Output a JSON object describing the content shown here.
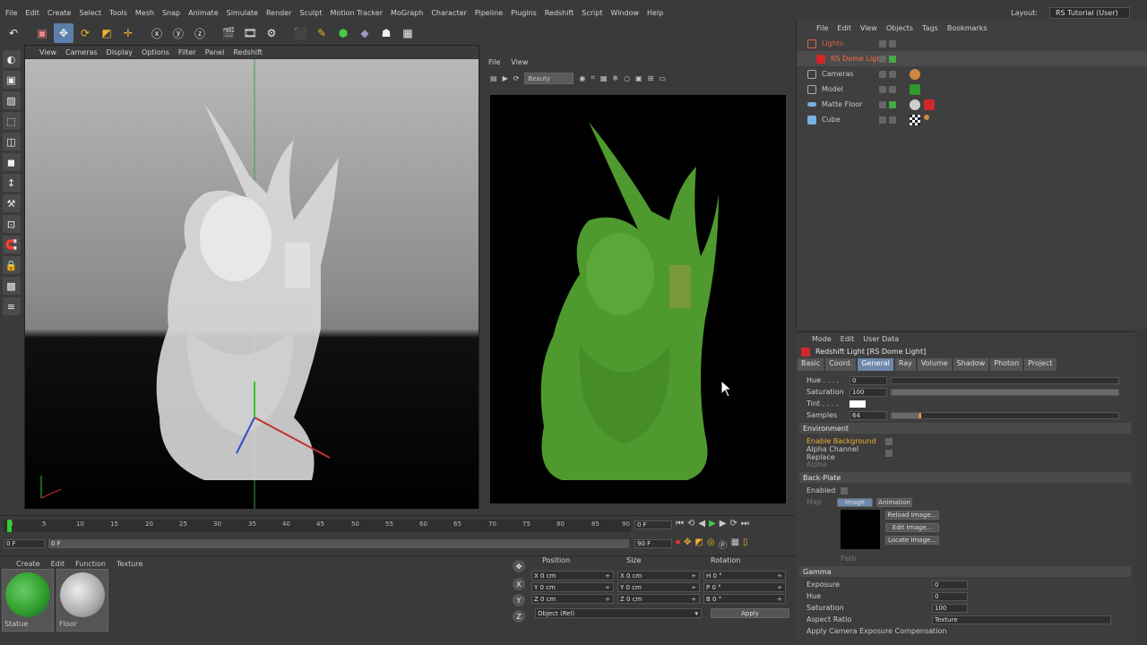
{
  "menubar": {
    "items": [
      "File",
      "Edit",
      "Create",
      "Select",
      "Tools",
      "Mesh",
      "Snap",
      "Animate",
      "Simulate",
      "Render",
      "Sculpt",
      "Motion Tracker",
      "MoGraph",
      "Character",
      "Pipeline",
      "Plugins",
      "Redshift",
      "Script",
      "Window",
      "Help"
    ],
    "layout_label": "Layout:",
    "layout_value": "RS Tutorial (User)"
  },
  "viewport": {
    "menu": [
      "View",
      "Cameras",
      "Display",
      "Options",
      "Filter",
      "Panel",
      "Redshift"
    ]
  },
  "renderview": {
    "menu": [
      "File",
      "View"
    ],
    "pass_dropdown": "Beauty"
  },
  "object_manager": {
    "menu": [
      "File",
      "Edit",
      "View",
      "Objects",
      "Tags",
      "Bookmarks"
    ],
    "rows": [
      {
        "name": "Lights",
        "color": "#e06040"
      },
      {
        "name": "RS Dome Light",
        "color": "#ff6b4a"
      },
      {
        "name": "Cameras",
        "color": "#d0d0d0"
      },
      {
        "name": "Model",
        "color": "#d0d0d0"
      },
      {
        "name": "Matte Floor",
        "color": "#d0d0d0"
      },
      {
        "name": "Cube",
        "color": "#d0d0d0"
      }
    ]
  },
  "attributes": {
    "menu": [
      "Mode",
      "Edit",
      "User Data"
    ],
    "title": "Redshift Light [RS Dome Light]",
    "tabs": [
      "Basic",
      "Coord.",
      "General",
      "Ray",
      "Volume",
      "Shadow",
      "Photon",
      "Project"
    ],
    "active_tab": "General",
    "fields": {
      "hue_label": "Hue . . . .",
      "hue_value": "0",
      "saturation_label": "Saturation",
      "saturation_value": "100",
      "tint_label": "Tint . . . .",
      "samples_label": "Samples",
      "samples_value": "64"
    },
    "environment": {
      "header": "Environment",
      "enable_background": "Enable Background",
      "alpha_channel_replace": "Alpha Channel Replace",
      "alpha": "Alpha"
    },
    "backplate": {
      "header": "Back-Plate",
      "enabled": "Enabled",
      "map": "Map",
      "image_btn": "Image",
      "animation_btn": "Animation",
      "reload": "Reload Image...",
      "edit": "Edit Image...",
      "locate": "Locate Image...",
      "path": "Path"
    },
    "gamma": {
      "header": "Gamma",
      "exposure": "Exposure",
      "exposure_value": "0",
      "hue": "Hue",
      "hue_value": "0",
      "saturation": "Saturation",
      "saturation_value": "100",
      "aspect_ratio": "Aspect Ratio",
      "aspect_value": "Texture",
      "apply_cam": "Apply Camera Exposure Compensation"
    }
  },
  "timeline": {
    "ticks": [
      "0",
      "5",
      "10",
      "15",
      "20",
      "25",
      "30",
      "35",
      "40",
      "45",
      "50",
      "55",
      "60",
      "65",
      "70",
      "75",
      "80",
      "85",
      "90"
    ],
    "current_frame": "0 F",
    "start_frame": "0 F",
    "range_start": "0 F",
    "range_end": "90 F",
    "end_frame": "90 F"
  },
  "materials": {
    "menu": [
      "Create",
      "Edit",
      "Function",
      "Texture"
    ],
    "items": [
      {
        "name": "Statue",
        "color": "#2f9a2a"
      },
      {
        "name": "Floor",
        "color": "#c8c8c8"
      }
    ]
  },
  "coords": {
    "headers": [
      "Position",
      "Size",
      "Rotation"
    ],
    "rows": [
      {
        "a": "X",
        "av": "0 cm",
        "b": "X",
        "bv": "0 cm",
        "c": "H",
        "cv": "0 °"
      },
      {
        "a": "Y",
        "av": "0 cm",
        "b": "Y",
        "bv": "0 cm",
        "c": "P",
        "cv": "0 °"
      },
      {
        "a": "Z",
        "av": "0 cm",
        "b": "Z",
        "bv": "0 cm",
        "c": "B",
        "cv": "0 °"
      }
    ],
    "mode": "Object (Rel)",
    "apply": "Apply"
  }
}
